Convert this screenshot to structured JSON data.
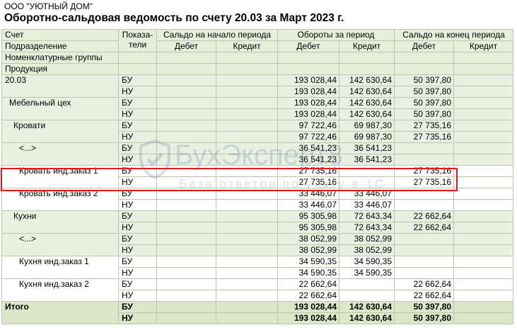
{
  "organization": "ООО \"УЮТНЫЙ ДОМ\"",
  "report_title": "Оборотно-сальдовая ведомость по счету 20.03 за Март 2023 г.",
  "header": {
    "dim1": "Счет",
    "dim2": "Подразделение",
    "dim3": "Номенклатурные группы",
    "dim4": "Продукция",
    "indicators": "Показа-\nтели",
    "opening": "Сальдо на начало периода",
    "turnover": "Обороты за период",
    "closing": "Сальдо на конец периода",
    "debit": "Дебет",
    "credit": "Кредит"
  },
  "rows": [
    {
      "name": "20.03",
      "ind": [
        "БУ",
        "НУ"
      ],
      "od": [
        "",
        ""
      ],
      "oc": [
        "",
        ""
      ],
      "td": [
        "193 028,44",
        "193 028,44"
      ],
      "tc": [
        "142 630,64",
        "142 630,64"
      ],
      "cd": [
        "50 397,80",
        "50 397,80"
      ],
      "cc": [
        "",
        ""
      ]
    },
    {
      "name": "Мебельный цех",
      "ind": [
        "БУ",
        "НУ"
      ],
      "od": [
        "",
        ""
      ],
      "oc": [
        "",
        ""
      ],
      "td": [
        "193 028,44",
        "193 028,44"
      ],
      "tc": [
        "142 630,64",
        "142 630,64"
      ],
      "cd": [
        "50 397,80",
        "50 397,80"
      ],
      "cc": [
        "",
        ""
      ]
    },
    {
      "name": "Кровати",
      "ind": [
        "БУ",
        "НУ"
      ],
      "od": [
        "",
        ""
      ],
      "oc": [
        "",
        ""
      ],
      "td": [
        "97 722,46",
        "97 722,46"
      ],
      "tc": [
        "69 987,30",
        "69 987,30"
      ],
      "cd": [
        "27 735,16",
        "27 735,16"
      ],
      "cc": [
        "",
        ""
      ]
    },
    {
      "name": "<...>",
      "ind": [
        "БУ",
        "НУ"
      ],
      "od": [
        "",
        ""
      ],
      "oc": [
        "",
        ""
      ],
      "td": [
        "36 541,23",
        "36 541,23"
      ],
      "tc": [
        "36 541,23",
        "36 541,23"
      ],
      "cd": [
        "",
        ""
      ],
      "cc": [
        "",
        ""
      ]
    },
    {
      "name": "Кровать инд.заказ 1",
      "ind": [
        "БУ",
        "НУ"
      ],
      "od": [
        "",
        ""
      ],
      "oc": [
        "",
        ""
      ],
      "td": [
        "27 735,16",
        "27 735,16"
      ],
      "tc": [
        "",
        ""
      ],
      "cd": [
        "27 735,16",
        "27 735,16"
      ],
      "cc": [
        "",
        ""
      ]
    },
    {
      "name": "Кровать инд.заказ 2",
      "ind": [
        "БУ",
        "НУ"
      ],
      "od": [
        "",
        ""
      ],
      "oc": [
        "",
        ""
      ],
      "td": [
        "33 446,07",
        "33 446,07"
      ],
      "tc": [
        "33 446,07",
        "33 446,07"
      ],
      "cd": [
        "",
        ""
      ],
      "cc": [
        "",
        ""
      ]
    },
    {
      "name": "Кухни",
      "ind": [
        "БУ",
        "НУ"
      ],
      "od": [
        "",
        ""
      ],
      "oc": [
        "",
        ""
      ],
      "td": [
        "95 305,98",
        "95 305,98"
      ],
      "tc": [
        "72 643,34",
        "72 643,34"
      ],
      "cd": [
        "22 662,64",
        "22 662,64"
      ],
      "cc": [
        "",
        ""
      ]
    },
    {
      "name": "<...>",
      "ind": [
        "БУ",
        "НУ"
      ],
      "od": [
        "",
        ""
      ],
      "oc": [
        "",
        ""
      ],
      "td": [
        "38 052,99",
        "38 052,99"
      ],
      "tc": [
        "38 052,99",
        "38 052,99"
      ],
      "cd": [
        "",
        ""
      ],
      "cc": [
        "",
        ""
      ]
    },
    {
      "name": "Кухня инд.заказ 1",
      "ind": [
        "БУ",
        "НУ"
      ],
      "od": [
        "",
        ""
      ],
      "oc": [
        "",
        ""
      ],
      "td": [
        "34 590,35",
        "34 590,35"
      ],
      "tc": [
        "34 590,35",
        "34 590,35"
      ],
      "cd": [
        "",
        ""
      ],
      "cc": [
        "",
        ""
      ]
    },
    {
      "name": "Кухня инд.заказ 2",
      "ind": [
        "БУ",
        "НУ"
      ],
      "od": [
        "",
        ""
      ],
      "oc": [
        "",
        ""
      ],
      "td": [
        "22 662,64",
        "22 662,64"
      ],
      "tc": [
        "",
        ""
      ],
      "cd": [
        "22 662,64",
        "22 662,64"
      ],
      "cc": [
        "",
        ""
      ]
    }
  ],
  "total": {
    "name": "Итого",
    "ind": [
      "БУ",
      "НУ"
    ],
    "od": [
      "",
      ""
    ],
    "oc": [
      "",
      ""
    ],
    "td": [
      "193 028,44",
      "193 028,44"
    ],
    "tc": [
      "142 630,64",
      "142 630,64"
    ],
    "cd": [
      "50 397,80",
      "50 397,80"
    ],
    "cc": [
      "",
      ""
    ]
  },
  "watermark": {
    "main": "БухЭксперт8",
    "sub": "База ответов по учету в 1С"
  },
  "colors": {
    "highlight": "#e8141c",
    "header_bg": "#e7efdc",
    "group_bg": "#e9f0e1",
    "total_bg": "#dbe7c8",
    "border": "#bcc7ab"
  }
}
